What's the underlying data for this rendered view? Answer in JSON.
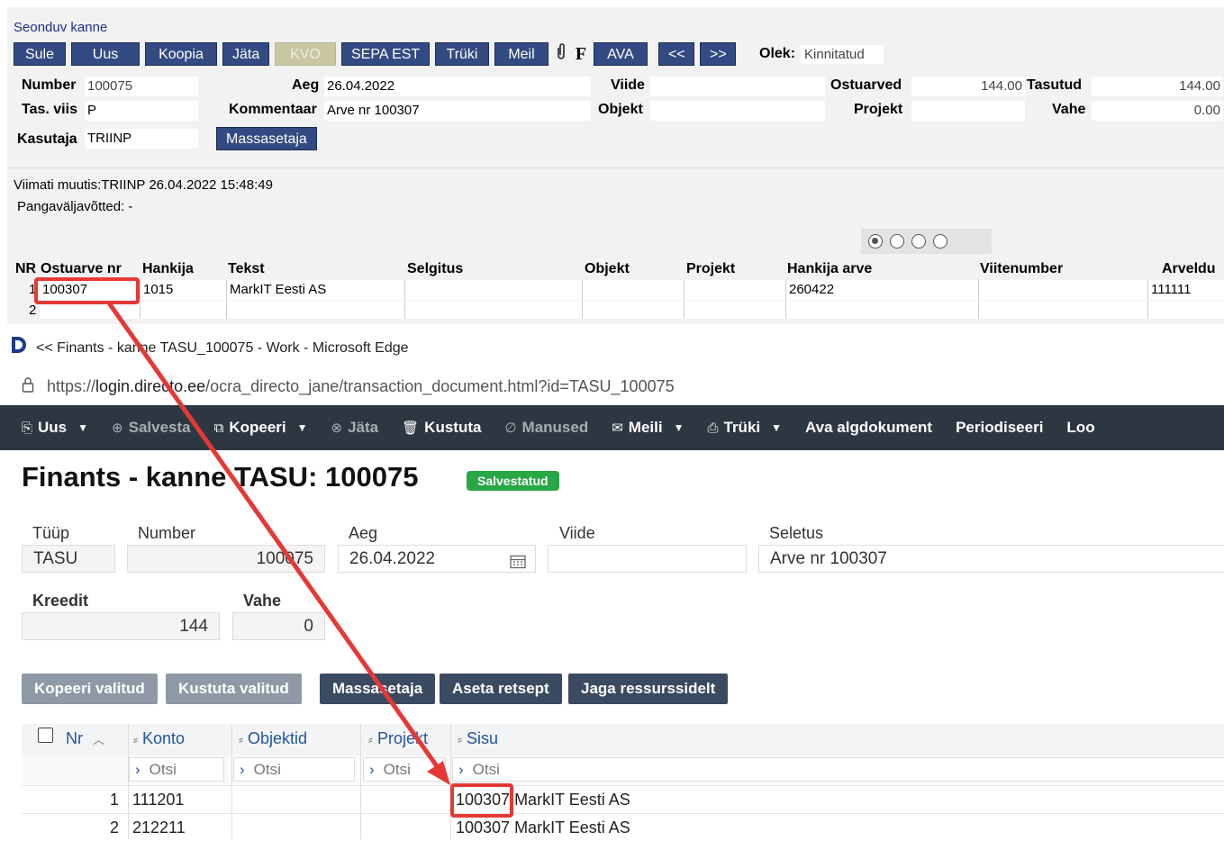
{
  "old": {
    "link": "Seonduv kanne",
    "toolbar": [
      "Sule",
      "Uus",
      "Koopia",
      "Jäta",
      "KVO",
      "SEPA EST",
      "Trüki",
      "Meil",
      "AVA",
      "<<",
      ">>"
    ],
    "f_glyph": "F",
    "olek_label": "Olek:",
    "olek_value": "Kinnitatud",
    "labels": {
      "number": "Number",
      "tasviis": "Tas. viis",
      "kasutaja": "Kasutaja",
      "aeg": "Aeg",
      "kommentaar": "Kommentaar",
      "viide": "Viide",
      "objekt": "Objekt",
      "ostuarved": "Ostuarved",
      "projekt": "Projekt",
      "tasutud": "Tasutud",
      "vahe": "Vahe"
    },
    "values": {
      "number": "100075",
      "tasviis": "P",
      "kasutaja": "TRIINP",
      "aeg": "26.04.2022",
      "kommentaar": "Arve nr 100307",
      "ostuarved": "144.00",
      "tasutud": "144.00",
      "vahe": "0.00"
    },
    "massasetaja": "Massasetaja",
    "viimati": "Viimati muutis:TRIINP 26.04.2022 15:48:49",
    "pangav": "Pangaväljavõtted: -",
    "headers": {
      "nr": "NR",
      "ostuarve": "Ostuarve nr",
      "hankija": "Hankija",
      "tekst": "Tekst",
      "selgitus": "Selgitus",
      "objekt": "Objekt",
      "projekt": "Projekt",
      "hankija_arve": "Hankija arve",
      "viitenumber": "Viitenumber",
      "arveldus": "Arveldu"
    },
    "row1": {
      "nr": "1",
      "ostuarve": "100307",
      "hankija": "1015",
      "tekst": "MarkIT Eesti AS",
      "hankija_arve": "260422",
      "arveldus": "111111"
    },
    "row2_nr": "2"
  },
  "edge": {
    "window_title": "<< Finants - kanne TASU_100075 - Work - Microsoft Edge",
    "url_prefix": "https://",
    "url_host": "login.directo.ee",
    "url_path": "/ocra_directo_jane/transaction_document.html?id=TASU_100075",
    "menu": [
      "Uus",
      "Salvesta",
      "Kopeeri",
      "Jäta",
      "Kustuta",
      "Manused",
      "Meili",
      "Trüki",
      "Ava algdokument",
      "Periodiseeri",
      "Loo"
    ],
    "heading": "Finants - kanne TASU: 100075",
    "badge": "Salvestatud",
    "labels": {
      "tyyp": "Tüüp",
      "number": "Number",
      "aeg": "Aeg",
      "viide": "Viide",
      "seletus": "Seletus",
      "kreedit": "Kreedit",
      "vahe": "Vahe"
    },
    "values": {
      "tyyp": "TASU",
      "number": "100075",
      "aeg": "26.04.2022",
      "viide": "",
      "seletus": "Arve nr 100307",
      "kreedit": "144",
      "vahe": "0"
    },
    "buttons": [
      "Kopeeri valitud",
      "Kustuta valitud",
      "Massasetaja",
      "Aseta retsept",
      "Jaga ressurssidelt"
    ],
    "columns": {
      "nr": "Nr",
      "konto": "Konto",
      "objektid": "Objektid",
      "projekt": "Projekt",
      "sisu": "Sisu"
    },
    "search_placeholder": "Otsi",
    "rows": [
      {
        "nr": "1",
        "konto": "111201",
        "sisu": "100307 MarkIT Eesti AS"
      },
      {
        "nr": "2",
        "konto": "212211",
        "sisu": "100307 MarkIT Eesti AS"
      }
    ]
  },
  "colors": {
    "old_button": "#334a82",
    "dark_bar": "#2d3742",
    "badge": "#28a745",
    "highlight": "#e53935"
  }
}
